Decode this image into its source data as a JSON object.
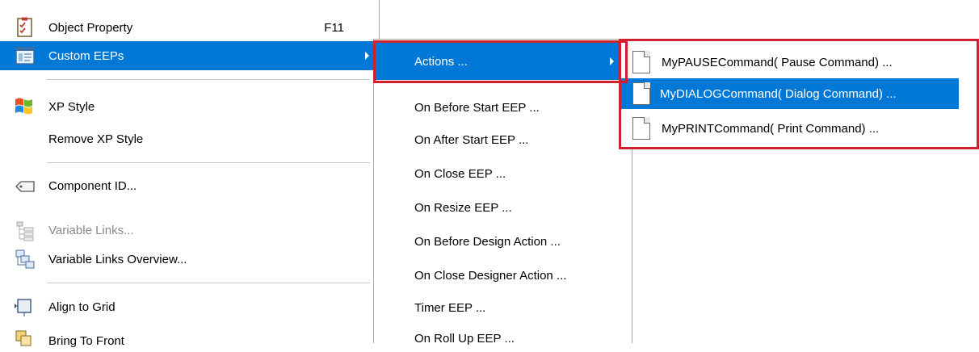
{
  "context_menu": {
    "items": [
      {
        "label": "Object Property",
        "shortcut": "F11"
      },
      {
        "label": "Custom EEPs"
      },
      {
        "label": "XP Style"
      },
      {
        "label": "Remove XP Style"
      },
      {
        "label": "Component ID..."
      },
      {
        "label": "Variable Links..."
      },
      {
        "label": "Variable Links Overview..."
      },
      {
        "label": "Align to Grid"
      },
      {
        "label": "Bring To Front"
      }
    ]
  },
  "custom_eeps_submenu": {
    "items": [
      {
        "label": "Actions ..."
      },
      {
        "label": "On Before Start EEP ..."
      },
      {
        "label": "On After Start EEP ..."
      },
      {
        "label": "On Close EEP ..."
      },
      {
        "label": "On Resize EEP ..."
      },
      {
        "label": "On Before Design Action ..."
      },
      {
        "label": "On Close Designer Action ..."
      },
      {
        "label": "Timer EEP ..."
      },
      {
        "label": "On Roll Up EEP ..."
      }
    ]
  },
  "actions_submenu": {
    "items": [
      {
        "label": "MyPAUSECommand( Pause Command) ..."
      },
      {
        "label": "MyDIALOGCommand( Dialog Command) ..."
      },
      {
        "label": "MyPRINTCommand( Print Command) ..."
      }
    ]
  },
  "colors": {
    "highlight": "#0078d7",
    "annotation_box": "#d0202f"
  }
}
